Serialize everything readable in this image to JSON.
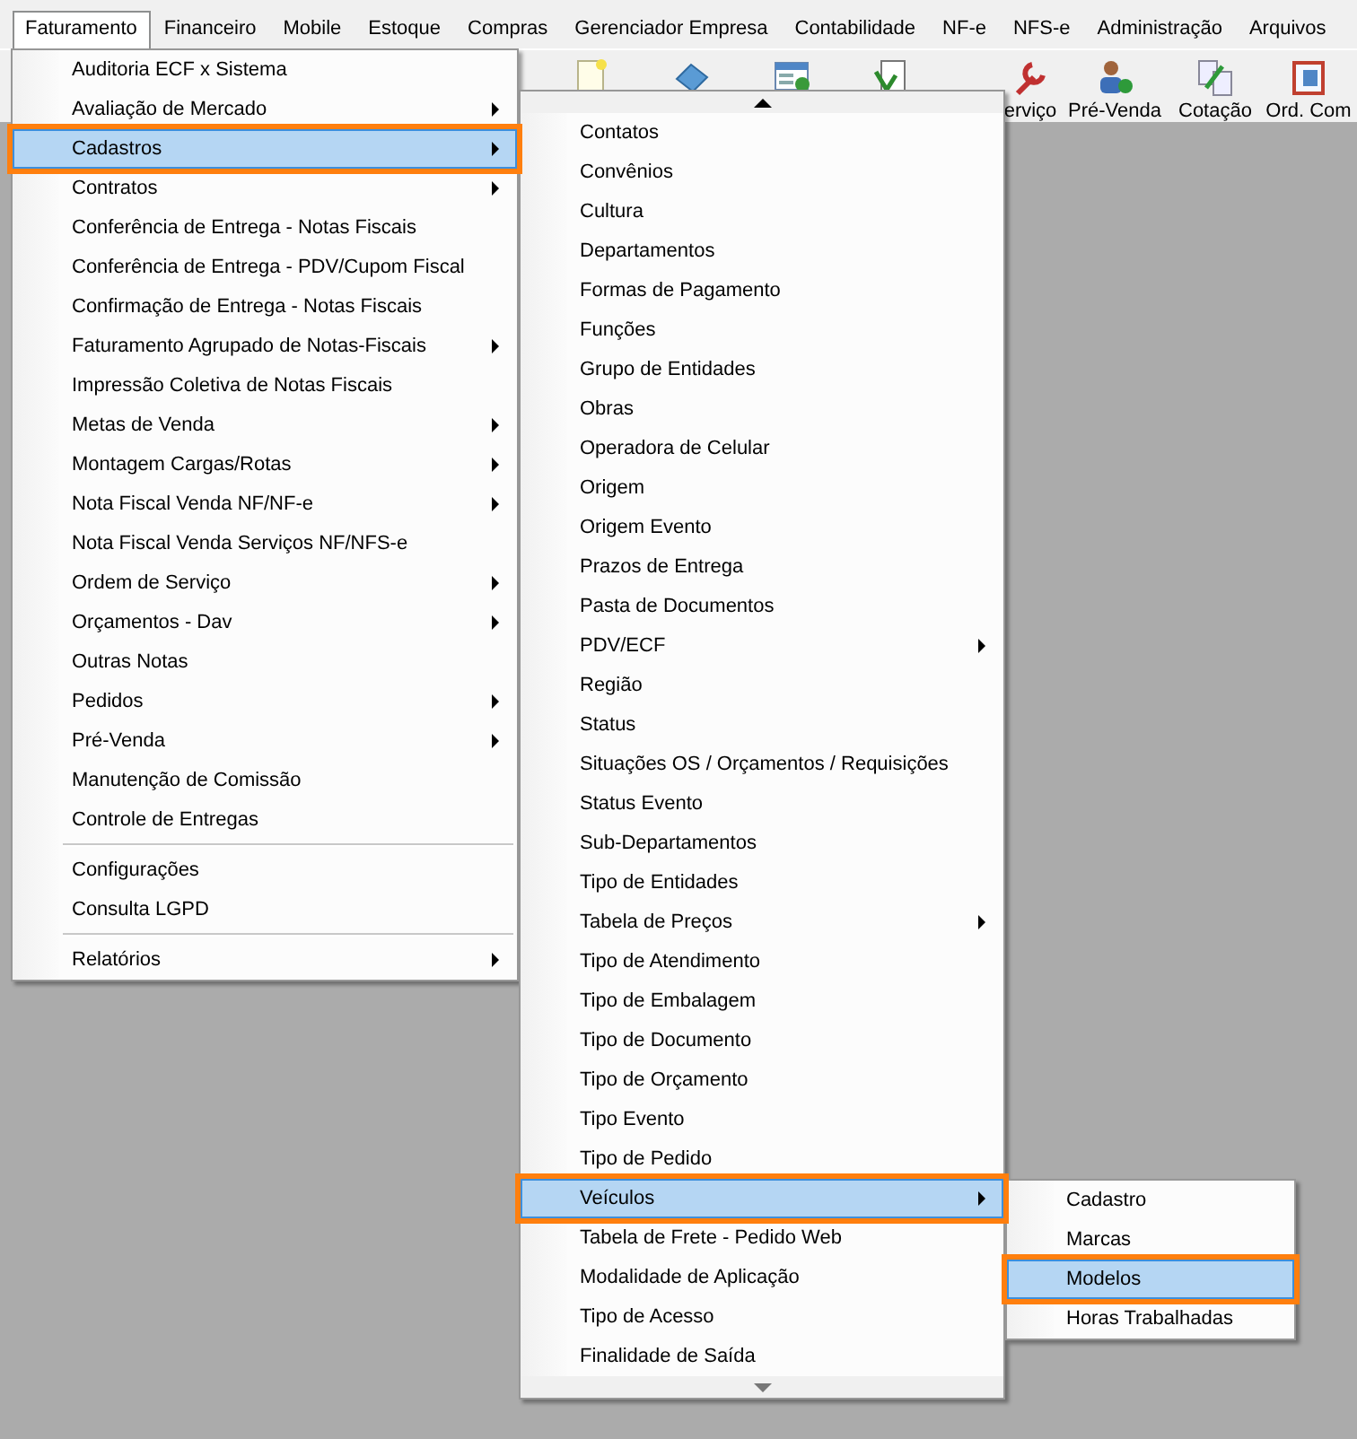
{
  "menu_bar": [
    {
      "label": "Faturamento",
      "selected": true
    },
    {
      "label": "Financeiro",
      "selected": false
    },
    {
      "label": "Mobile",
      "selected": false
    },
    {
      "label": "Estoque",
      "selected": false
    },
    {
      "label": "Compras",
      "selected": false
    },
    {
      "label": "Gerenciador Empresa",
      "selected": false
    },
    {
      "label": "Contabilidade",
      "selected": false
    },
    {
      "label": "NF-e",
      "selected": false
    },
    {
      "label": "NFS-e",
      "selected": false
    },
    {
      "label": "Administração",
      "selected": false
    },
    {
      "label": "Arquivos",
      "selected": false
    }
  ],
  "toolbar": [
    {
      "label": "erviço"
    },
    {
      "label": "Pré-Venda"
    },
    {
      "label": "Cotação"
    },
    {
      "label": "Ord. Com"
    }
  ],
  "faturamento_menu": {
    "sections": [
      [
        {
          "label": "Auditoria ECF x Sistema",
          "submenu": false,
          "selected": false
        },
        {
          "label": "Avaliação de Mercado",
          "submenu": true,
          "selected": false
        },
        {
          "label": "Cadastros",
          "submenu": true,
          "selected": true
        },
        {
          "label": "Contratos",
          "submenu": true,
          "selected": false
        },
        {
          "label": "Conferência de Entrega - Notas Fiscais",
          "submenu": false,
          "selected": false
        },
        {
          "label": "Conferência de Entrega - PDV/Cupom Fiscal",
          "submenu": false,
          "selected": false
        },
        {
          "label": "Confirmação de Entrega - Notas Fiscais",
          "submenu": false,
          "selected": false
        },
        {
          "label": "Faturamento Agrupado de Notas-Fiscais",
          "submenu": true,
          "selected": false
        },
        {
          "label": "Impressão Coletiva de Notas Fiscais",
          "submenu": false,
          "selected": false
        },
        {
          "label": "Metas de Venda",
          "submenu": true,
          "selected": false
        },
        {
          "label": "Montagem Cargas/Rotas",
          "submenu": true,
          "selected": false
        },
        {
          "label": "Nota Fiscal Venda NF/NF-e",
          "submenu": true,
          "selected": false
        },
        {
          "label": "Nota Fiscal Venda Serviços NF/NFS-e",
          "submenu": false,
          "selected": false
        },
        {
          "label": "Ordem de Serviço",
          "submenu": true,
          "selected": false
        },
        {
          "label": "Orçamentos - Dav",
          "submenu": true,
          "selected": false
        },
        {
          "label": "Outras Notas",
          "submenu": false,
          "selected": false
        },
        {
          "label": "Pedidos",
          "submenu": true,
          "selected": false
        },
        {
          "label": "Pré-Venda",
          "submenu": true,
          "selected": false
        },
        {
          "label": "Manutenção de Comissão",
          "submenu": false,
          "selected": false
        },
        {
          "label": "Controle de Entregas",
          "submenu": false,
          "selected": false
        }
      ],
      [
        {
          "label": "Configurações",
          "submenu": false,
          "selected": false
        },
        {
          "label": "Consulta LGPD",
          "submenu": false,
          "selected": false
        }
      ],
      [
        {
          "label": "Relatórios",
          "submenu": true,
          "selected": false
        }
      ]
    ]
  },
  "cadastros_menu": {
    "sections": [
      [
        {
          "label": "Contatos",
          "submenu": false,
          "selected": false
        },
        {
          "label": "Convênios",
          "submenu": false,
          "selected": false
        },
        {
          "label": "Cultura",
          "submenu": false,
          "selected": false
        },
        {
          "label": "Departamentos",
          "submenu": false,
          "selected": false
        },
        {
          "label": "Formas de Pagamento",
          "submenu": false,
          "selected": false
        },
        {
          "label": "Funções",
          "submenu": false,
          "selected": false
        },
        {
          "label": "Grupo de Entidades",
          "submenu": false,
          "selected": false
        },
        {
          "label": "Obras",
          "submenu": false,
          "selected": false
        },
        {
          "label": "Operadora de Celular",
          "submenu": false,
          "selected": false
        },
        {
          "label": "Origem",
          "submenu": false,
          "selected": false
        },
        {
          "label": "Origem Evento",
          "submenu": false,
          "selected": false
        },
        {
          "label": "Prazos de Entrega",
          "submenu": false,
          "selected": false
        },
        {
          "label": "Pasta de Documentos",
          "submenu": false,
          "selected": false
        },
        {
          "label": "PDV/ECF",
          "submenu": true,
          "selected": false
        },
        {
          "label": "Região",
          "submenu": false,
          "selected": false
        },
        {
          "label": "Status",
          "submenu": false,
          "selected": false
        },
        {
          "label": "Situações OS / Orçamentos / Requisições",
          "submenu": false,
          "selected": false
        },
        {
          "label": "Status Evento",
          "submenu": false,
          "selected": false
        },
        {
          "label": "Sub-Departamentos",
          "submenu": false,
          "selected": false
        },
        {
          "label": "Tipo de Entidades",
          "submenu": false,
          "selected": false
        },
        {
          "label": "Tabela de Preços",
          "submenu": true,
          "selected": false
        },
        {
          "label": "Tipo de Atendimento",
          "submenu": false,
          "selected": false
        },
        {
          "label": "Tipo de Embalagem",
          "submenu": false,
          "selected": false
        },
        {
          "label": "Tipo de Documento",
          "submenu": false,
          "selected": false
        },
        {
          "label": "Tipo de Orçamento",
          "submenu": false,
          "selected": false
        },
        {
          "label": "Tipo Evento",
          "submenu": false,
          "selected": false
        },
        {
          "label": "Tipo de Pedido",
          "submenu": false,
          "selected": false
        },
        {
          "label": "Veículos",
          "submenu": true,
          "selected": true
        },
        {
          "label": "Tabela de Frete - Pedido Web",
          "submenu": false,
          "selected": false
        },
        {
          "label": "Modalidade de Aplicação",
          "submenu": false,
          "selected": false
        },
        {
          "label": "Tipo de Acesso",
          "submenu": false,
          "selected": false
        },
        {
          "label": "Finalidade de Saída",
          "submenu": false,
          "selected": false
        }
      ]
    ]
  },
  "veiculos_menu": {
    "sections": [
      [
        {
          "label": "Cadastro",
          "submenu": false,
          "selected": false
        },
        {
          "label": "Marcas",
          "submenu": false,
          "selected": false
        },
        {
          "label": "Modelos",
          "submenu": false,
          "selected": true
        },
        {
          "label": "Horas Trabalhadas",
          "submenu": false,
          "selected": false
        }
      ]
    ]
  }
}
